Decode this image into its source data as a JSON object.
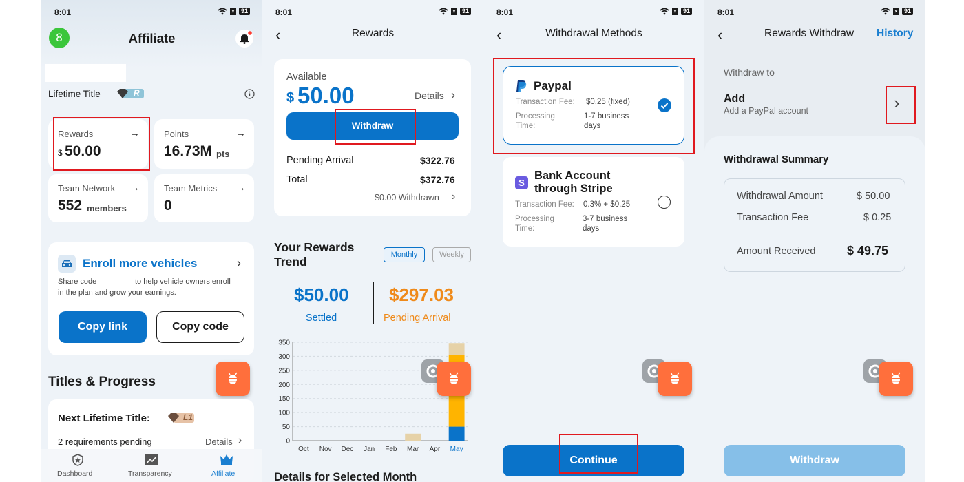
{
  "status": {
    "time": "8:01",
    "battery": "91"
  },
  "s1": {
    "avatar_initial": "8",
    "title": "Affiliate",
    "lifetime_title_label": "Lifetime Title",
    "title_badge": "R",
    "rewards": {
      "label": "Rewards",
      "currency": "$",
      "value": "50.00"
    },
    "points": {
      "label": "Points",
      "value": "16.73M",
      "unit": "pts"
    },
    "team_network": {
      "label": "Team Network",
      "value": "552",
      "unit": "members"
    },
    "team_metrics": {
      "label": "Team Metrics",
      "value": "0"
    },
    "enroll": {
      "title": "Enroll more vehicles",
      "desc_a": "Share code",
      "desc_b": "to help vehicle owners enroll",
      "desc_c": "in the plan and grow your earnings."
    },
    "copy_link": "Copy link",
    "copy_code": "Copy code",
    "section_title": "Titles & Progress",
    "next_title_label": "Next Lifetime Title:",
    "next_badge": "L1",
    "requirements": "2 requirements pending",
    "details": "Details",
    "nav": [
      "Dashboard",
      "Transparency",
      "Affiliate"
    ]
  },
  "s2": {
    "title": "Rewards",
    "available_label": "Available",
    "currency": "$",
    "available_value": "50.00",
    "details_link": "Details",
    "withdraw_button": "Withdraw",
    "pending_label": "Pending Arrival",
    "pending_value": "$322.76",
    "total_label": "Total",
    "total_value": "$372.76",
    "withdrawn_link": "$0.00 Withdrawn",
    "trend_title_1": "Your Rewards",
    "trend_title_2": "Trend",
    "monthly": "Monthly",
    "weekly": "Weekly",
    "settled_value": "$50.00",
    "settled_label": "Settled",
    "pending_big_value": "$297.03",
    "pending_big_label": "Pending Arrival",
    "details_selected": "Details for Selected Month"
  },
  "chart_data": {
    "type": "bar",
    "categories": [
      "Oct",
      "Nov",
      "Dec",
      "Jan",
      "Feb",
      "Mar",
      "Apr",
      "May"
    ],
    "series": [
      {
        "values": [
          0,
          0,
          0,
          0,
          0,
          0,
          0,
          50
        ],
        "color": "#0a73c9"
      },
      {
        "values": [
          0,
          0,
          0,
          0,
          0,
          0,
          0,
          255
        ],
        "color": "#ffb400"
      },
      {
        "values": [
          0,
          0,
          0,
          0,
          0,
          25,
          0,
          42
        ],
        "color": "#e6d2a8"
      }
    ],
    "ylim": [
      0,
      350
    ],
    "yticks": [
      0,
      50,
      100,
      150,
      200,
      250,
      300,
      350
    ],
    "highlight_category": "May",
    "grid": true
  },
  "s3": {
    "title": "Withdrawal Methods",
    "paypal": {
      "name": "Paypal",
      "fee_label": "Transaction Fee:",
      "fee_value": "$0.25 (fixed)",
      "time_label_1": "Processing",
      "time_label_2": "Time:",
      "time_value_1": "1-7 business",
      "time_value_2": "days"
    },
    "stripe": {
      "name_1": "Bank Account",
      "name_2": "through Stripe",
      "fee_label": "Transaction Fee:",
      "fee_value": "0.3% + $0.25",
      "time_label_1": "Processing",
      "time_label_2": "Time:",
      "time_value_1": "3-7 business",
      "time_value_2": "days"
    },
    "continue_button": "Continue"
  },
  "s4": {
    "title": "Rewards Withdraw",
    "history": "History",
    "withdraw_to": "Withdraw to",
    "add_title": "Add",
    "add_sub": "Add a PayPal account",
    "summary_title": "Withdrawal Summary",
    "amount_label": "Withdrawal Amount",
    "amount_value": "$ 50.00",
    "fee_label": "Transaction Fee",
    "fee_value": "$ 0.25",
    "received_label": "Amount Received",
    "received_value": "$ 49.75",
    "withdraw_button": "Withdraw"
  },
  "colors": {
    "primary": "#0a73c9",
    "orange": "#ef8a1a",
    "highlight": "#e0191f",
    "fab": "#ff6f3c"
  }
}
